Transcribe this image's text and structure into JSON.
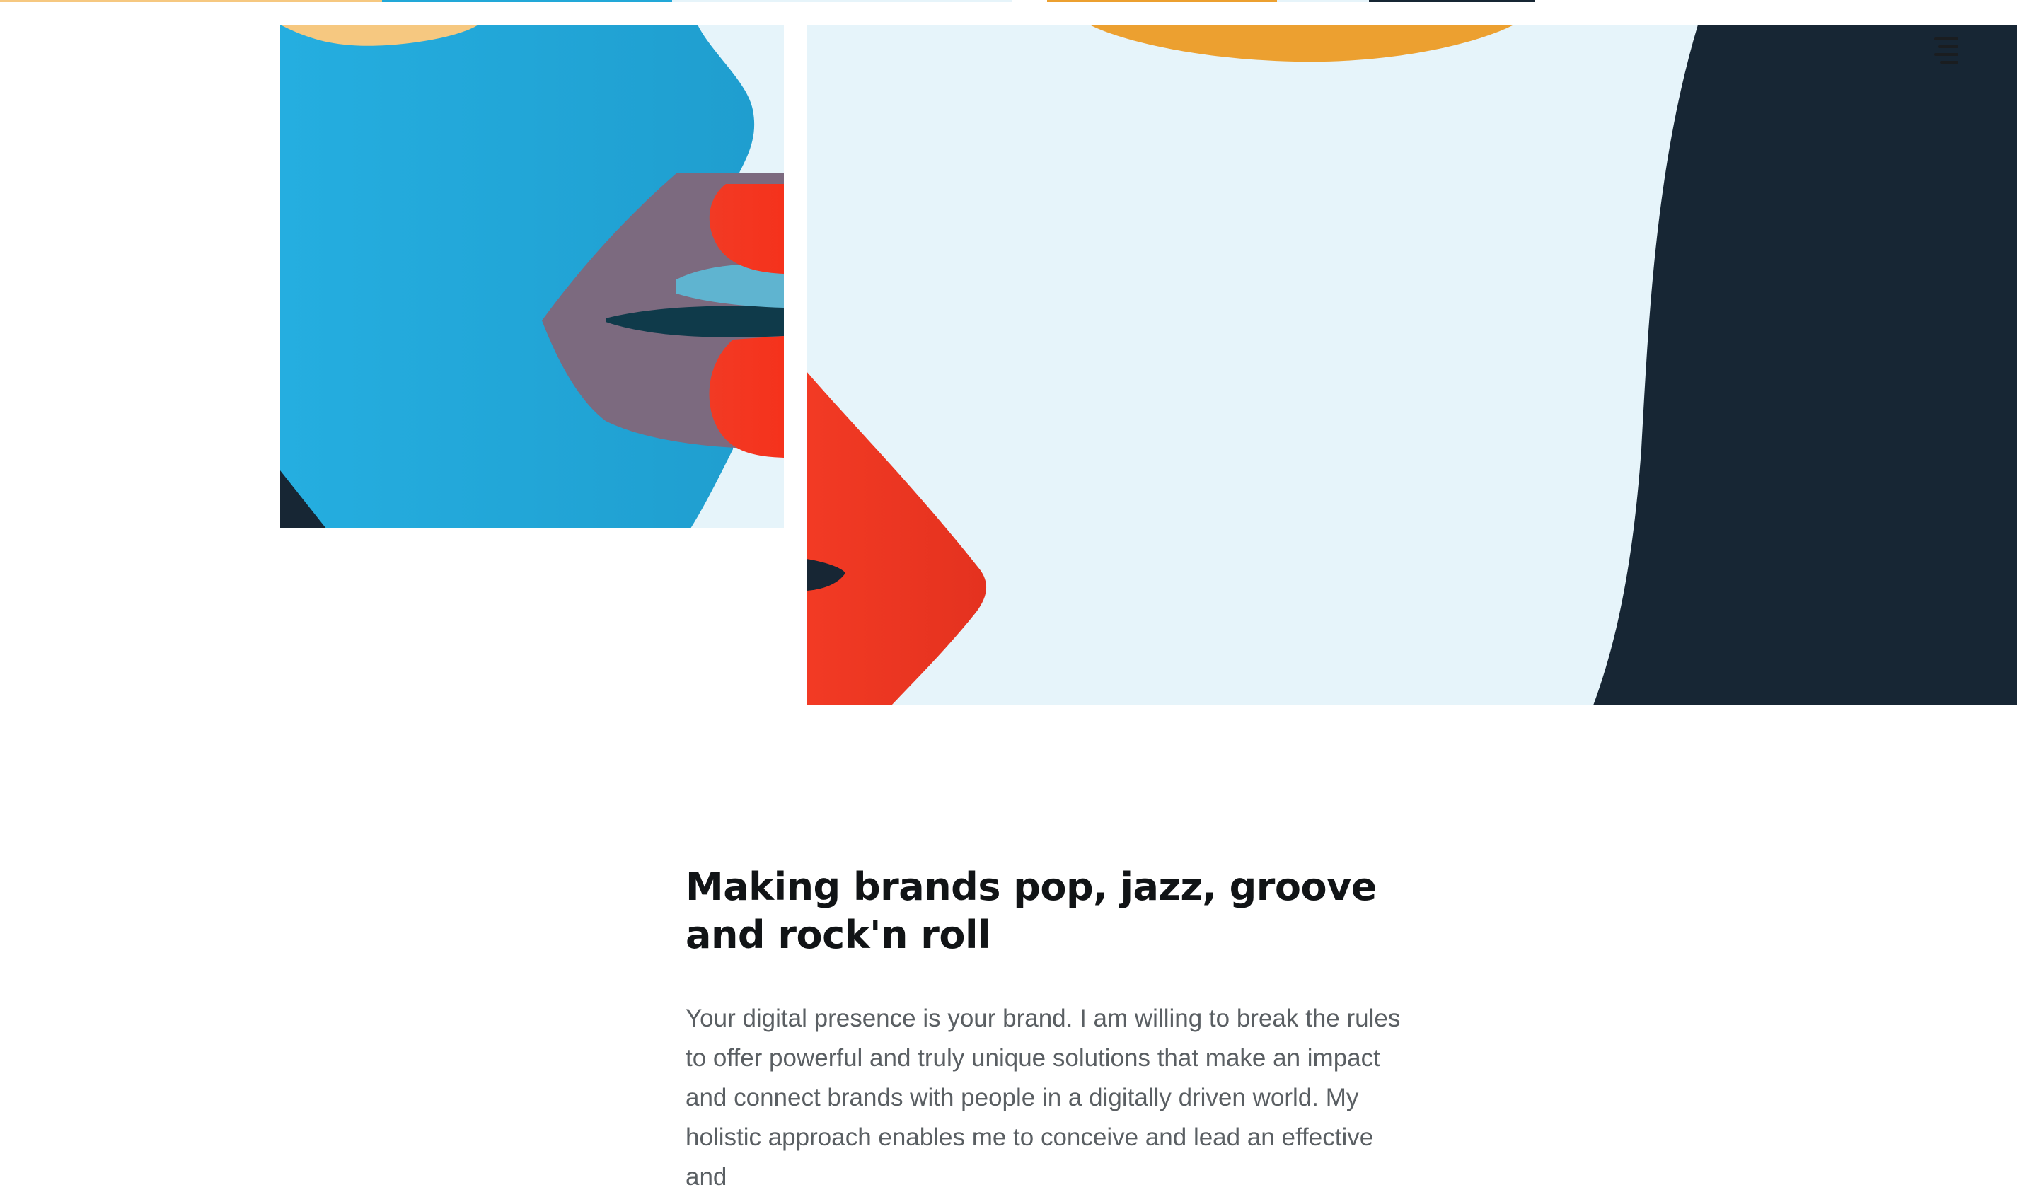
{
  "page": {
    "headline": "Making brands pop, jazz, groove and rock'n roll",
    "intro": "Your digital presence is your brand. I am willing to break the rules to offer powerful and truly unique solutions that make an impact and connect brands with people in a digitally driven world. My holistic approach enables me to conceive and lead an effective and"
  },
  "header": {
    "menu_icon": "menu-icon"
  },
  "artwork": {
    "description_icon_names": [
      "lips-illustration-close-up",
      "lips-illustration-wide"
    ]
  },
  "colors": {
    "sky_blue": "#22a8d8",
    "pale_blue": "#e6f4fa",
    "lip_red": "#f23a24",
    "lip_mauve": "#7c6a7f",
    "navy": "#172634",
    "orange": "#eca030",
    "peach": "#f6c880",
    "text_dark": "#111416",
    "text_gray": "#5a5f63"
  }
}
